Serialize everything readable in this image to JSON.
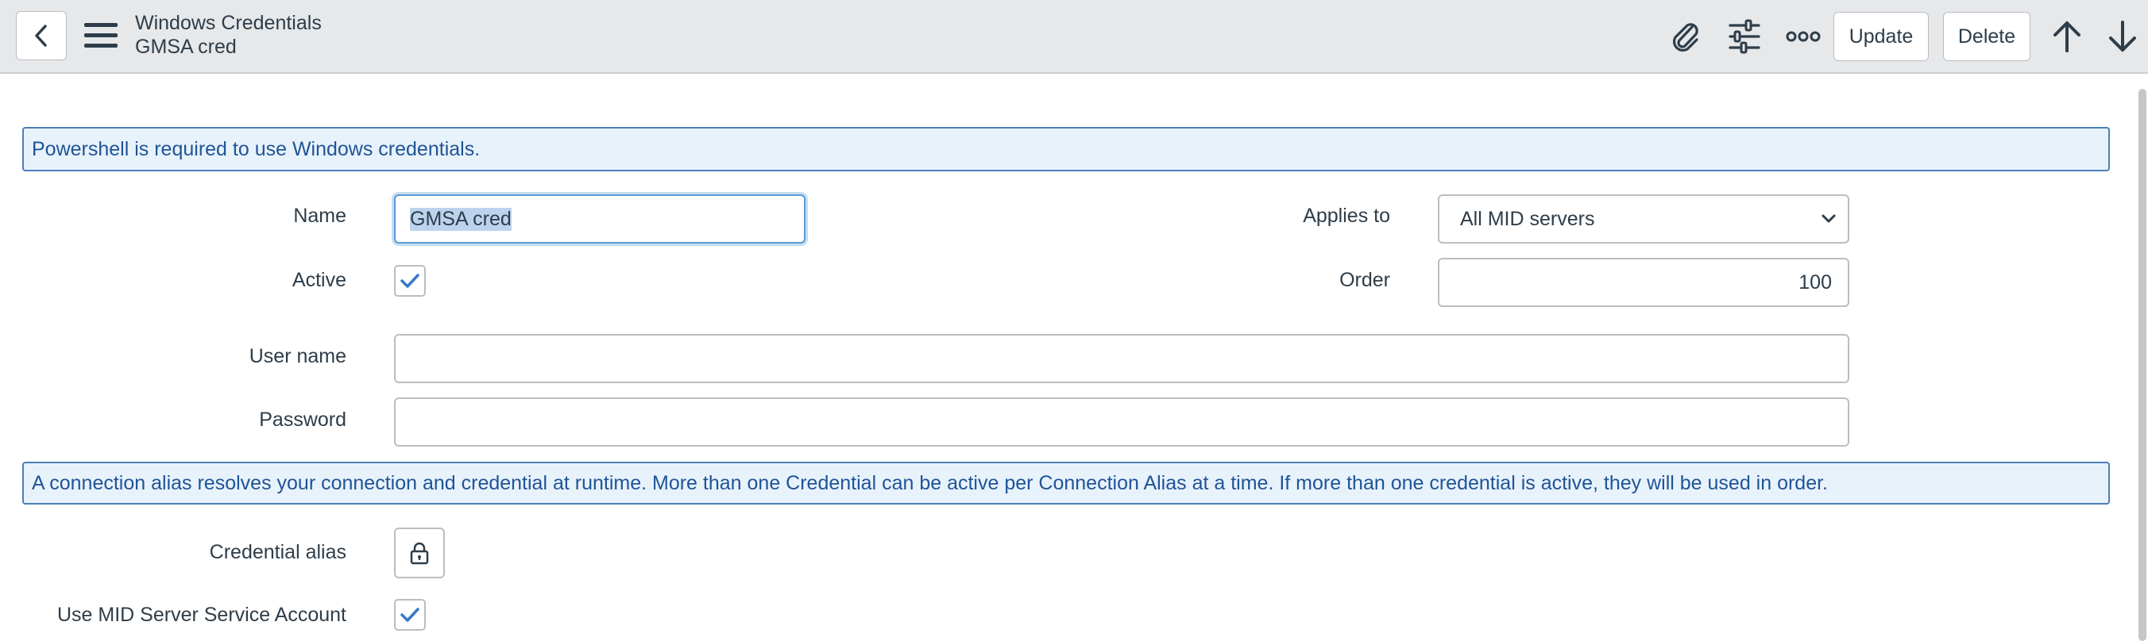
{
  "header": {
    "back_icon": "chevron-left-icon",
    "menu_icon": "hamburger-menu-icon",
    "title": "Windows Credentials",
    "subtitle": "GMSA cred",
    "attachment_icon": "paperclip-icon",
    "personalize_icon": "sliders-icon",
    "more_icon": "more-options-icon",
    "update_label": "Update",
    "delete_label": "Delete",
    "prev_icon": "arrow-up-icon",
    "next_icon": "arrow-down-icon"
  },
  "banners": {
    "powershell": "Powershell is required to use Windows credentials.",
    "alias_info": "A connection alias resolves your connection and credential at runtime. More than one Credential can be active per Connection Alias at a time. If more than one credential is active, they will be used in order."
  },
  "form": {
    "name": {
      "label": "Name",
      "value": "GMSA cred"
    },
    "active": {
      "label": "Active",
      "checked": true
    },
    "applies_to": {
      "label": "Applies to",
      "value": "All MID servers"
    },
    "order": {
      "label": "Order",
      "value": "100"
    },
    "user_name": {
      "label": "User name",
      "value": ""
    },
    "password": {
      "label": "Password",
      "value": ""
    },
    "credential_alias": {
      "label": "Credential alias",
      "icon": "lock-icon"
    },
    "use_mid_account": {
      "label": "Use MID Server Service Account",
      "checked": true
    }
  },
  "colors": {
    "header_bg": "#e6e8ea",
    "banner_bg": "#e8f2fb",
    "banner_border": "#4a7fb8",
    "banner_text": "#1f5497",
    "check_color": "#3a78c9",
    "focus_border": "#5b9bd5"
  }
}
